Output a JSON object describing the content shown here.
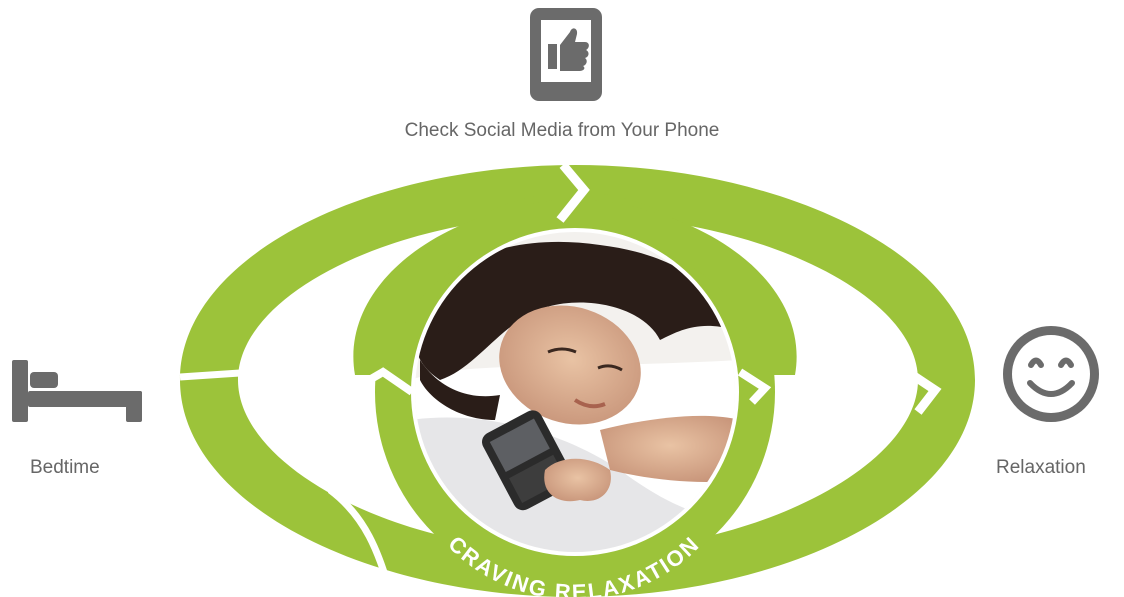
{
  "diagram": {
    "top_step": {
      "label": "Check Social Media from Your Phone",
      "icon": "phone-thumbs-up-icon"
    },
    "left_step": {
      "label": "Bedtime",
      "icon": "bed-icon"
    },
    "right_step": {
      "label": "Relaxation",
      "icon": "smiley-face-icon"
    },
    "center": {
      "caption": "CRAVING RELAXATION",
      "image": "woman-in-bed-with-phone-photo"
    }
  },
  "colors": {
    "loop_green": "#9cc33a",
    "icon_gray": "#6b6b6b",
    "label_gray": "#666666",
    "background": "#ffffff"
  }
}
